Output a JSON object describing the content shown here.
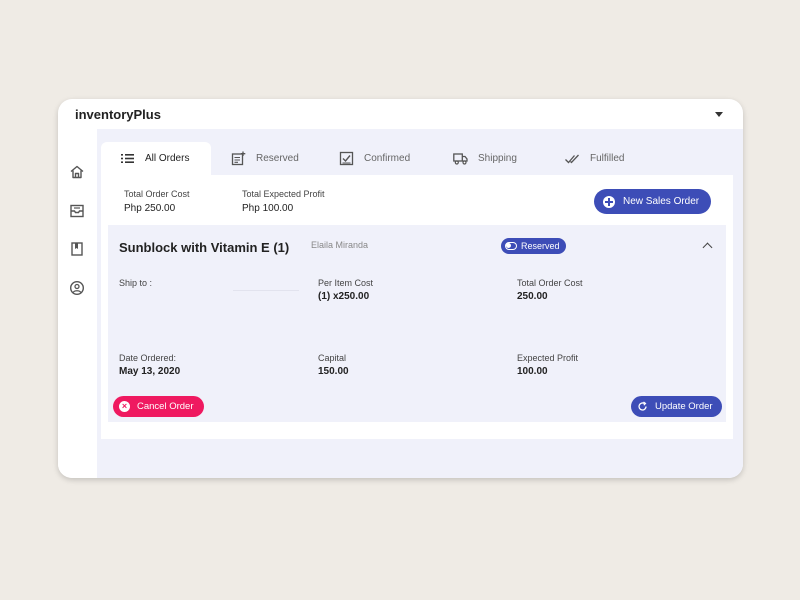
{
  "app": {
    "title": "inventoryPlus"
  },
  "sidebar": {
    "items": [
      {
        "icon": "home-icon"
      },
      {
        "icon": "inbox-icon"
      },
      {
        "icon": "book-icon"
      },
      {
        "icon": "user-icon"
      }
    ]
  },
  "tabs": [
    {
      "label": "All Orders",
      "icon": "list-icon",
      "active": true
    },
    {
      "label": "Reserved",
      "icon": "note-add-icon",
      "active": false
    },
    {
      "label": "Confirmed",
      "icon": "checkbox-icon",
      "active": false
    },
    {
      "label": "Shipping",
      "icon": "truck-icon",
      "active": false
    },
    {
      "label": "Fulfilled",
      "icon": "double-check-icon",
      "active": false
    }
  ],
  "summary": {
    "total_cost_label": "Total Order Cost",
    "total_cost_value": "Php 250.00",
    "expected_profit_label": "Total Expected Profit",
    "expected_profit_value": "Php 100.00",
    "new_order_label": "New Sales Order"
  },
  "order": {
    "title": "Sunblock with Vitamin E (1)",
    "customer": "Elaila Miranda",
    "status": "Reserved",
    "ship_to_label": "Ship to :",
    "ship_to_value": "",
    "per_item_cost_label": "Per Item Cost",
    "per_item_cost_value": "(1) x250.00",
    "total_order_cost_label": "Total Order Cost",
    "total_order_cost_value": "250.00",
    "date_ordered_label": "Date Ordered:",
    "date_ordered_value": "May 13, 2020",
    "capital_label": "Capital",
    "capital_value": "150.00",
    "expected_profit_label": "Expected Profit",
    "expected_profit_value": "100.00",
    "cancel_label": "Cancel Order",
    "update_label": "Update Order"
  },
  "colors": {
    "accent": "#3d4db7",
    "danger": "#ef1960",
    "content_bg": "#f0f1fa",
    "page_bg": "#efebe5"
  }
}
